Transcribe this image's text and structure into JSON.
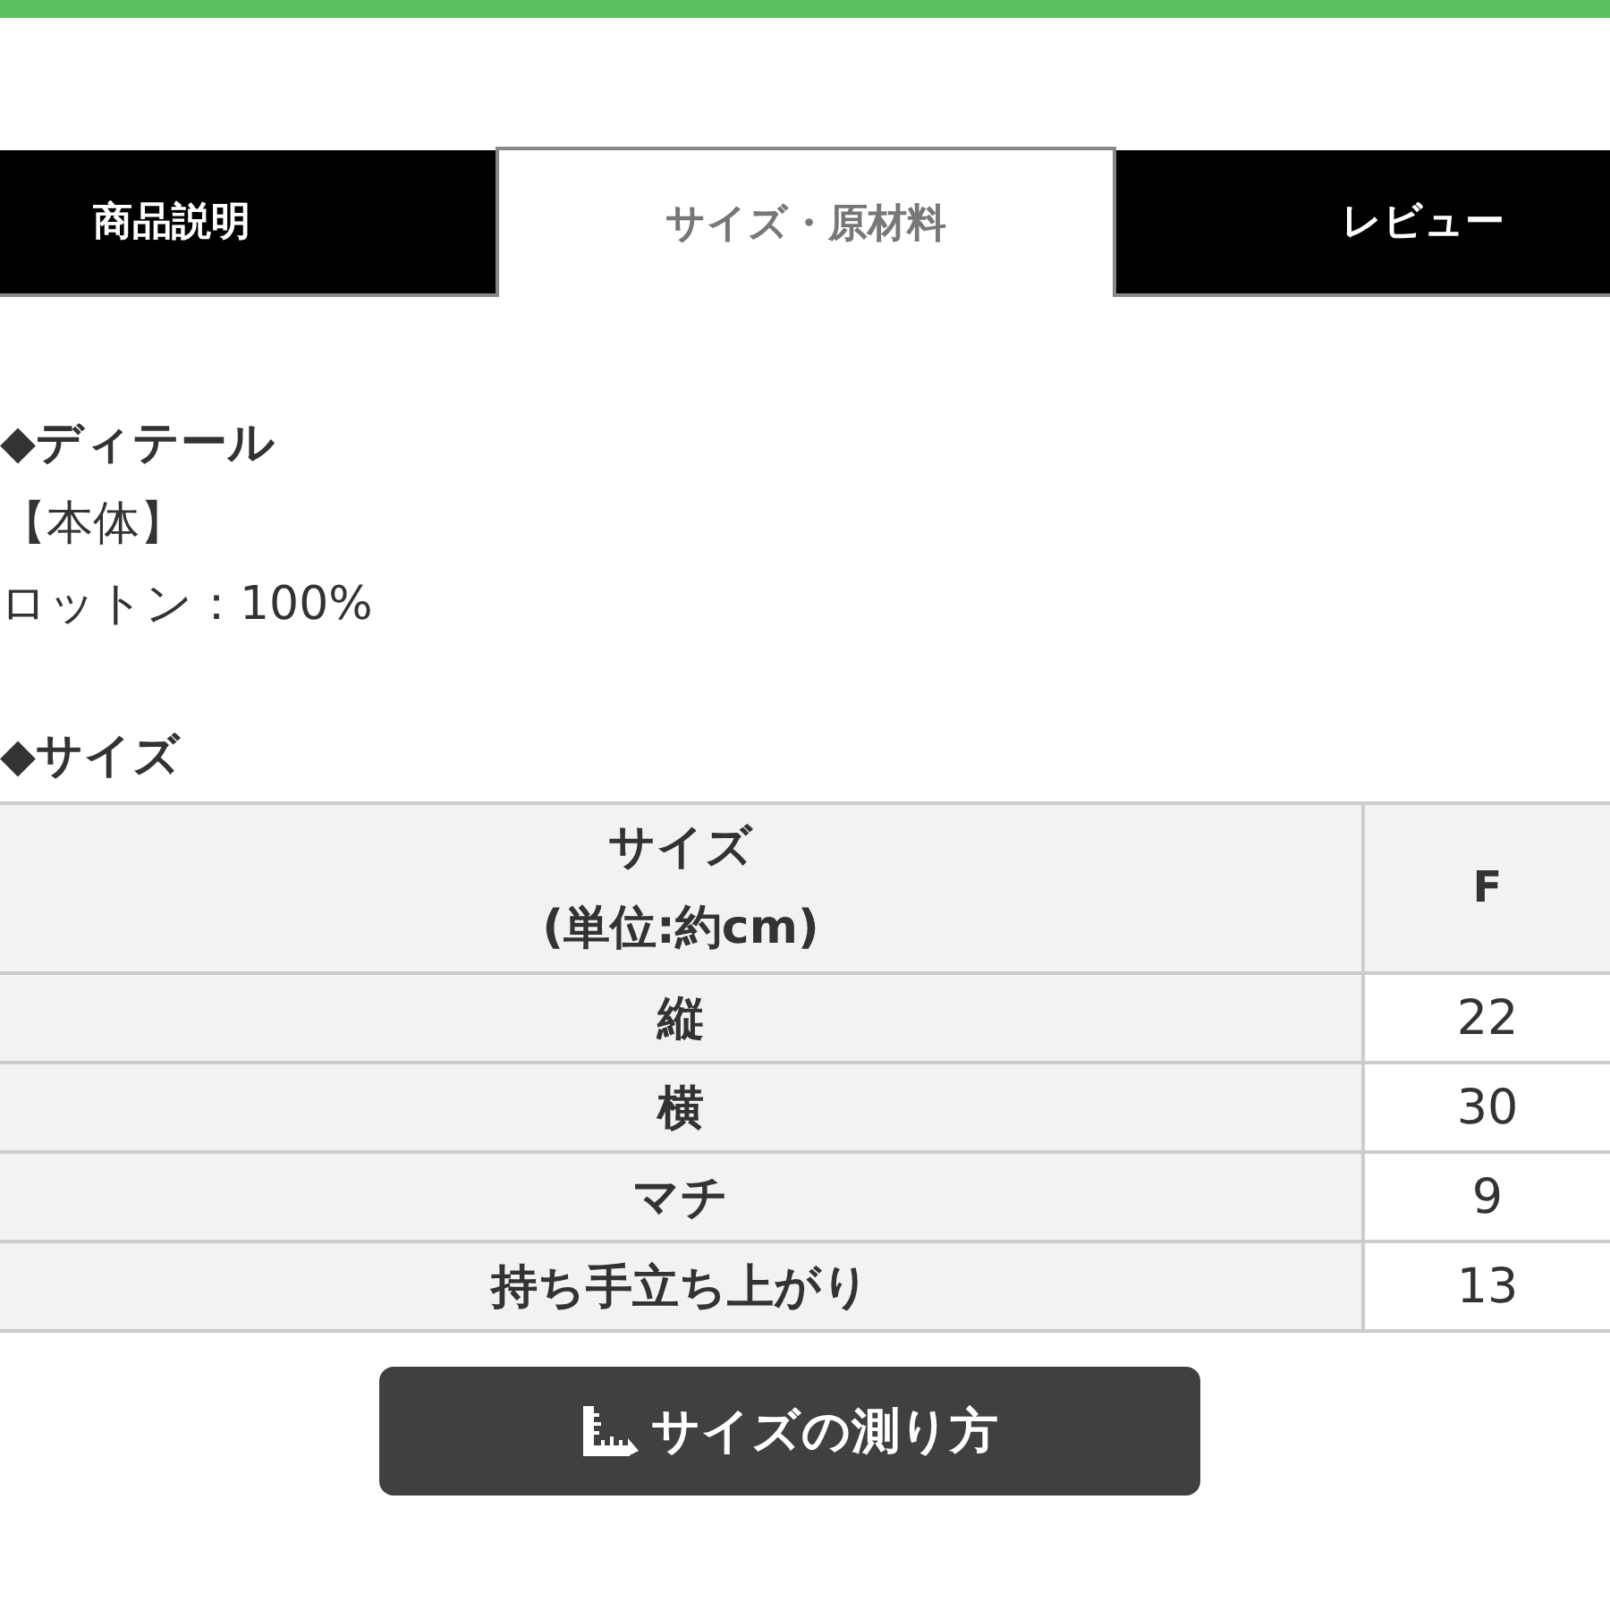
{
  "tabs": [
    {
      "label": "商品説明",
      "selected": false
    },
    {
      "label": "サイズ・原材料",
      "selected": true
    },
    {
      "label": "レビュー",
      "selected": false
    }
  ],
  "details": {
    "heading": "◆ディテール",
    "lines": [
      "【本体】",
      "ロットン：100%"
    ]
  },
  "size": {
    "heading": "◆サイズ",
    "table": {
      "columns": [
        "サイズ\n(単位:約cm)",
        "F"
      ],
      "rows": [
        [
          "縦",
          "22"
        ],
        [
          "横",
          "30"
        ],
        [
          "マチ",
          "9"
        ],
        [
          "持ち手立ち上がり",
          "13"
        ]
      ]
    }
  },
  "button": {
    "label": "サイズの測り方"
  }
}
